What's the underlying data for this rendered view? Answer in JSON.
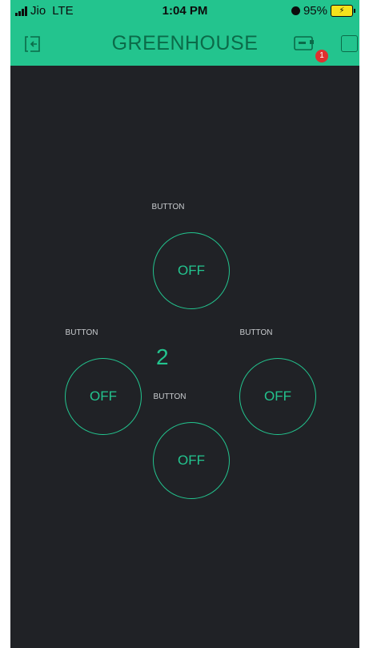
{
  "status_bar": {
    "carrier": "Jio",
    "network": "LTE",
    "time": "1:04 PM",
    "battery_percent": "95%"
  },
  "header": {
    "title": "GREENHOUSE",
    "notification_count": "1",
    "back_icon": "exit-icon",
    "device_icon": "device-icon",
    "square_icon": "square-icon"
  },
  "widgets": {
    "button_top": {
      "label": "BUTTON",
      "state": "OFF"
    },
    "button_left": {
      "label": "BUTTON",
      "state": "OFF"
    },
    "button_right": {
      "label": "BUTTON",
      "state": "OFF"
    },
    "button_bottom": {
      "label": "BUTTON",
      "state": "OFF"
    },
    "value_display": "2"
  },
  "colors": {
    "accent": "#23c48e",
    "background": "#202226",
    "badge": "#e0302f"
  }
}
